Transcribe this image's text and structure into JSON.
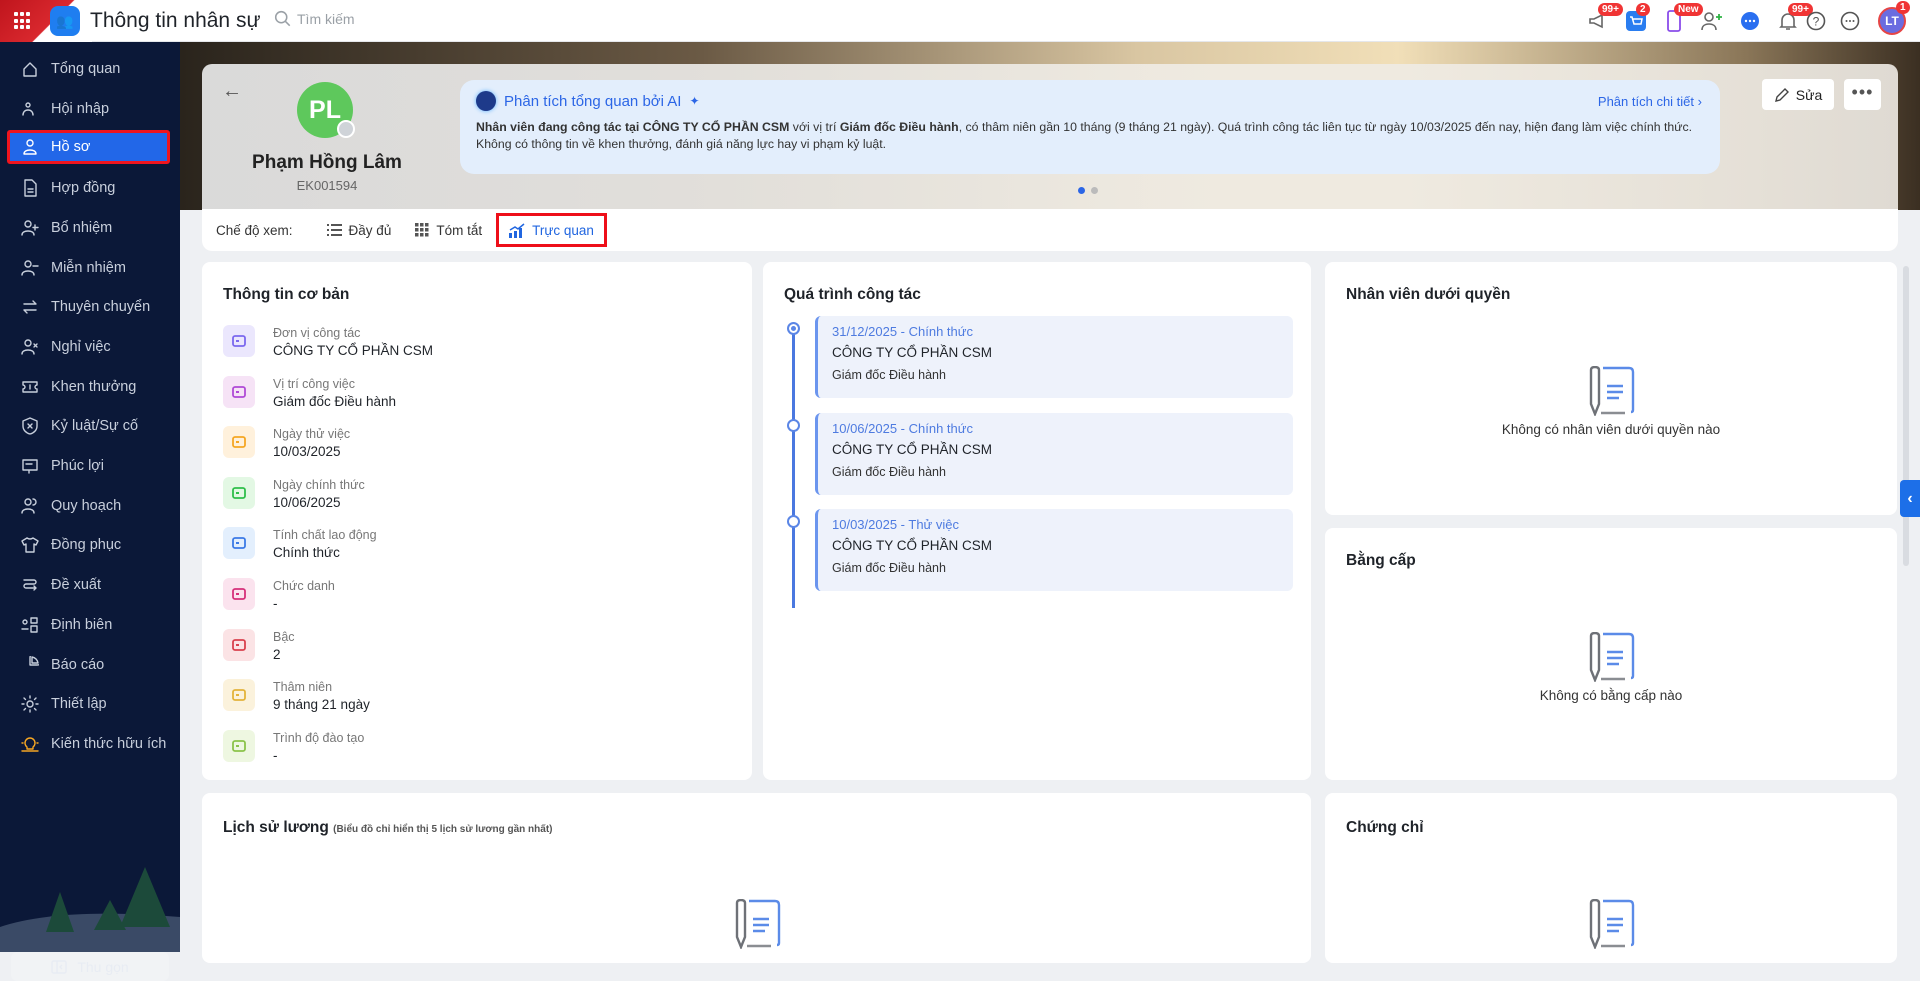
{
  "header": {
    "title": "Thông tin nhân sự",
    "search_placeholder": "Tìm kiếm",
    "badges": {
      "announce": "99+",
      "cart": "2",
      "mobile": "New",
      "bell": "99+",
      "avatar": "1"
    },
    "avatar_initials": "LT"
  },
  "sidebar": {
    "items": [
      {
        "label": "Tổng quan",
        "icon": "home-icon"
      },
      {
        "label": "Hội nhập",
        "icon": "group-icon"
      },
      {
        "label": "Hồ sơ",
        "icon": "user-icon"
      },
      {
        "label": "Hợp đồng",
        "icon": "document-icon"
      },
      {
        "label": "Bổ nhiệm",
        "icon": "user-plus-icon"
      },
      {
        "label": "Miễn nhiệm",
        "icon": "user-minus-icon"
      },
      {
        "label": "Thuyên chuyển",
        "icon": "transfer-icon"
      },
      {
        "label": "Nghỉ việc",
        "icon": "user-x-icon"
      },
      {
        "label": "Khen thưởng",
        "icon": "ticket-icon"
      },
      {
        "label": "Kỷ luật/Sự cố",
        "icon": "shield-icon"
      },
      {
        "label": "Phúc lợi",
        "icon": "benefit-icon"
      },
      {
        "label": "Quy hoạch",
        "icon": "users-icon"
      },
      {
        "label": "Đồng phục",
        "icon": "shirt-icon"
      },
      {
        "label": "Đề xuất",
        "icon": "route-icon"
      },
      {
        "label": "Định biên",
        "icon": "org-icon"
      },
      {
        "label": "Báo cáo",
        "icon": "pie-icon"
      },
      {
        "label": "Thiết lập",
        "icon": "gear-icon"
      },
      {
        "label": "Kiến thức hữu ích",
        "icon": "bulb-icon"
      }
    ],
    "active_index": 2,
    "collapse_label": "Thu gọn"
  },
  "profile": {
    "initials": "PL",
    "name": "Phạm Hồng Lâm",
    "code": "EK001594",
    "edit_label": "Sửa",
    "ai": {
      "title": "Phân tích tổng quan bởi AI",
      "detail_link": "Phân tích chi tiết",
      "text_b1": "Nhân viên đang công tác tại CÔNG TY CỔ PHẦN CSM",
      "text_1": " với vị trí ",
      "text_b2": "Giám đốc Điều hành",
      "text_2": ", có thâm niên gần 10 tháng (9 tháng 21 ngày). Quá trình công tác liên tục từ ngày 10/03/2025 đến nay, hiện đang làm việc chính thức.",
      "text_3": "Không có thông tin về khen thưởng, đánh giá năng lực hay vi phạm kỷ luật."
    },
    "view_mode": {
      "label": "Chế độ xem:",
      "options": [
        "Đầy đủ",
        "Tóm tắt",
        "Trực quan"
      ],
      "active": "Trực quan"
    }
  },
  "basic": {
    "title": "Thông tin cơ bản",
    "rows": [
      {
        "label": "Đơn vị công tác",
        "value": "CÔNG TY CỔ PHẦN CSM",
        "color": "#7b68ee",
        "bg": "#ebe7fd"
      },
      {
        "label": "Vị trí công việc",
        "value": "Giám đốc Điều hành",
        "color": "#b04ad6",
        "bg": "#f6e3f6"
      },
      {
        "label": "Ngày thử việc",
        "value": "10/03/2025",
        "color": "#f5a623",
        "bg": "#fff1dc"
      },
      {
        "label": "Ngày chính thức",
        "value": "10/06/2025",
        "color": "#2fbf4a",
        "bg": "#e3f8e4"
      },
      {
        "label": "Tính chất lao động",
        "value": "Chính thức",
        "color": "#3b7ae6",
        "bg": "#e3effd"
      },
      {
        "label": "Chức danh",
        "value": "-",
        "color": "#d6307a",
        "bg": "#fbe3ee"
      },
      {
        "label": "Bậc",
        "value": "2",
        "color": "#d9414e",
        "bg": "#fbe3e5"
      },
      {
        "label": "Thâm niên",
        "value": "9 tháng 21 ngày",
        "color": "#e3b33b",
        "bg": "#fbf2dc"
      },
      {
        "label": "Trình độ đào tạo",
        "value": "-",
        "color": "#8bc34a",
        "bg": "#eef7e1"
      }
    ]
  },
  "work": {
    "title": "Quá trình công tác",
    "items": [
      {
        "date": "31/12/2025 - Chính thức",
        "company": "CÔNG TY CỔ PHẦN CSM",
        "position": "Giám đốc Điều hành",
        "current": true
      },
      {
        "date": "10/06/2025 - Chính thức",
        "company": "CÔNG TY CỔ PHẦN CSM",
        "position": "Giám đốc Điều hành",
        "current": false
      },
      {
        "date": "10/03/2025 - Thử việc",
        "company": "CÔNG TY CỔ PHẦN CSM",
        "position": "Giám đốc Điều hành",
        "current": false
      }
    ]
  },
  "subordinates": {
    "title": "Nhân viên dưới quyền",
    "empty": "Không có nhân viên dưới quyền nào"
  },
  "degrees": {
    "title": "Bằng cấp",
    "empty": "Không có bằng cấp nào"
  },
  "salary": {
    "title": "Lịch sử lương",
    "note": "(Biểu đồ chỉ hiển thị 5 lịch sử lương gần nhất)"
  },
  "certificates": {
    "title": "Chứng chỉ"
  }
}
